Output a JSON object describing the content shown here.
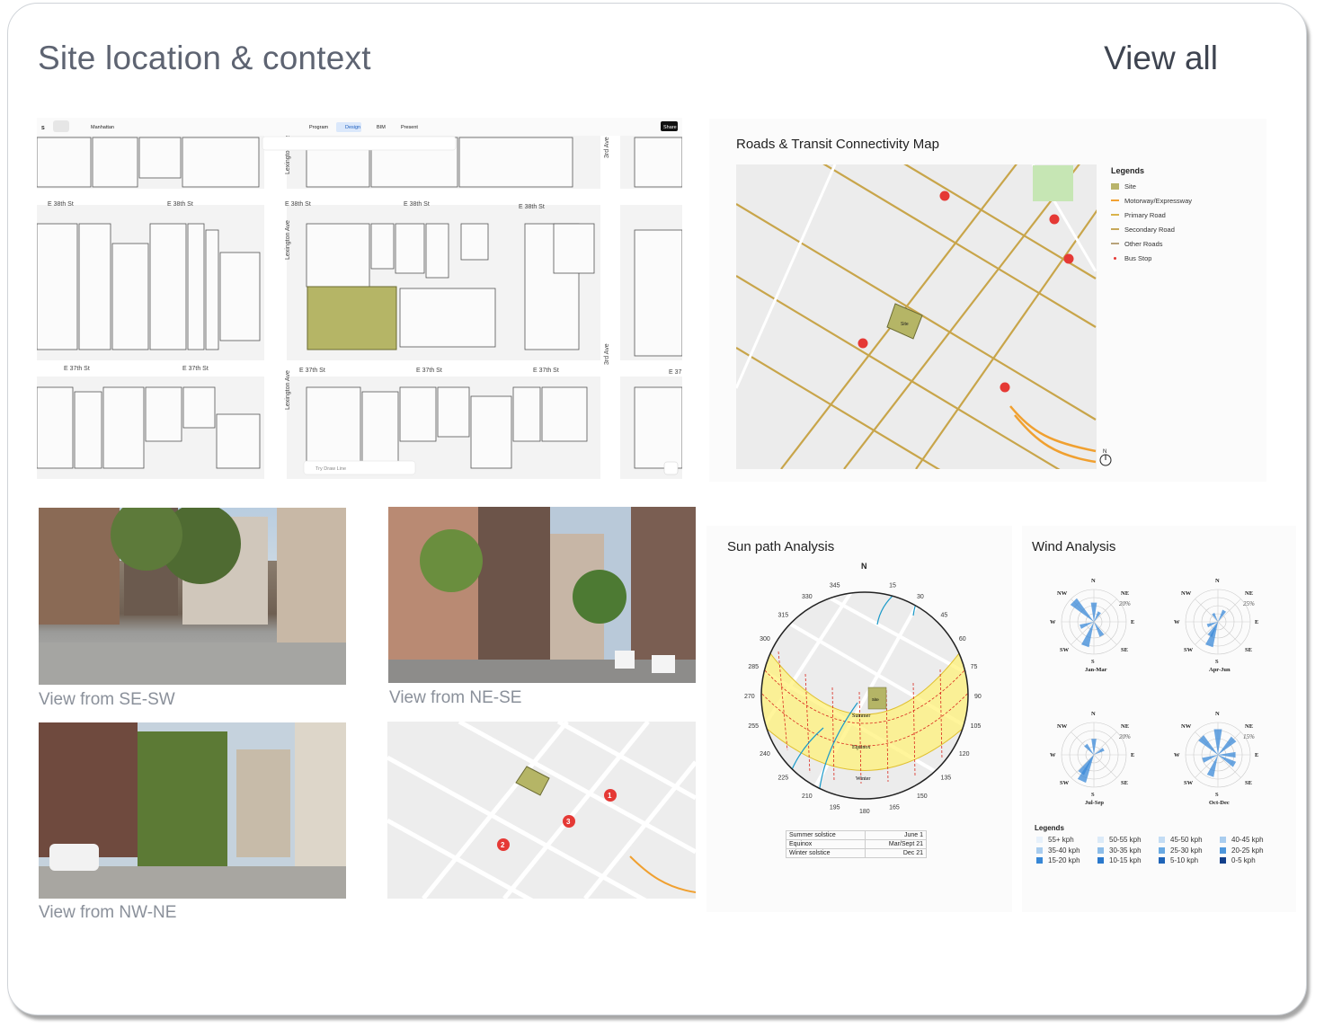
{
  "header": {
    "title": "Site location & context",
    "view_all": "View all"
  },
  "editor": {
    "project": "Manhattan",
    "tabs": [
      "Program",
      "Design",
      "BIM",
      "Present"
    ],
    "active_tab": "Design",
    "share": "Share",
    "search_placeholder": "Try Draw Line",
    "streets": {
      "e38": [
        "E 38th St",
        "E 38th St",
        "E 38th St",
        "E 38th St",
        "E 38th St"
      ],
      "e37": [
        "E 37th St",
        "E 37th St",
        "E 37th St",
        "E 37th St",
        "E 37th St",
        "E 37"
      ],
      "lex": [
        "Lexington Ave",
        "Lexington Ave",
        "Lexington Ave"
      ],
      "third": [
        "3rd Ave",
        "3rd Ave"
      ]
    }
  },
  "roads_map": {
    "title": "Roads & Transit Connectivity Map",
    "site_label": "Site",
    "north": "N",
    "legend_title": "Legends",
    "legend": [
      {
        "label": "Site",
        "color": "#b9b46a",
        "kind": "box"
      },
      {
        "label": "Motorway/Expressway",
        "color": "#f2a233",
        "kind": "line"
      },
      {
        "label": "Primary Road",
        "color": "#d9b34a",
        "kind": "line"
      },
      {
        "label": "Secondary Road",
        "color": "#c7a85a",
        "kind": "line"
      },
      {
        "label": "Other Roads",
        "color": "#b8a37a",
        "kind": "line"
      },
      {
        "label": "Bus Stop",
        "color": "#e53935",
        "kind": "dot"
      }
    ]
  },
  "photos": [
    {
      "caption": "View from SE-SW"
    },
    {
      "caption": "View from NE-SE"
    },
    {
      "caption": "View from NW-NE"
    }
  ],
  "keymap": {
    "markers": [
      "1",
      "2",
      "3"
    ]
  },
  "sun_path": {
    "title": "Sun path Analysis",
    "north": "N",
    "bearings": [
      "345",
      "15",
      "330",
      "30",
      "315",
      "45",
      "300",
      "60",
      "285",
      "75",
      "270",
      "90",
      "255",
      "105",
      "240",
      "120",
      "225",
      "135",
      "210",
      "150",
      "195",
      "165",
      "180"
    ],
    "bands": [
      "Summer",
      "Equinox",
      "Winter"
    ],
    "site_label": "Site",
    "table": [
      {
        "event": "Summer solstice",
        "date": "June 1"
      },
      {
        "event": "Equinox",
        "date": "Mar/Sept 21"
      },
      {
        "event": "Winter solstice",
        "date": "Dec 21"
      }
    ]
  },
  "wind": {
    "title": "Wind Analysis",
    "roses": [
      {
        "period": "Jan-Mar",
        "scale": "20%",
        "dirs": {
          "n": "N",
          "ne": "NE",
          "e": "E",
          "se": "SE",
          "s": "S",
          "sw": "SW",
          "w": "W",
          "nw": "NW"
        }
      },
      {
        "period": "Apr-Jun",
        "scale": "25%",
        "dirs": {
          "n": "N",
          "ne": "NE",
          "e": "E",
          "se": "SE",
          "s": "S",
          "sw": "SW",
          "w": "W",
          "nw": "NW"
        }
      },
      {
        "period": "Jul-Sep",
        "scale": "20%",
        "dirs": {
          "n": "N",
          "ne": "NE",
          "e": "E",
          "se": "SE",
          "s": "S",
          "sw": "SW",
          "w": "W",
          "nw": "NW"
        }
      },
      {
        "period": "Oct-Dec",
        "scale": "15%",
        "dirs": {
          "n": "N",
          "ne": "NE",
          "e": "E",
          "se": "SE",
          "s": "S",
          "sw": "SW",
          "w": "W",
          "nw": "NW"
        }
      }
    ],
    "legend_title": "Legends",
    "legend": [
      {
        "label": "55+ kph",
        "color": "#e7f1fb"
      },
      {
        "label": "50-55 kph",
        "color": "#dbeaf8"
      },
      {
        "label": "45-50 kph",
        "color": "#c3dcf4"
      },
      {
        "label": "40-45 kph",
        "color": "#a9cdef"
      },
      {
        "label": "35-40 kph",
        "color": "#a9cdef"
      },
      {
        "label": "30-35 kph",
        "color": "#8dbde9"
      },
      {
        "label": "25-30 kph",
        "color": "#6aaae3"
      },
      {
        "label": "20-25 kph",
        "color": "#4e97dc"
      },
      {
        "label": "15-20 kph",
        "color": "#3787d6"
      },
      {
        "label": "10-15 kph",
        "color": "#2a78cc"
      },
      {
        "label": "5-10 kph",
        "color": "#1f64b8"
      },
      {
        "label": "0-5 kph",
        "color": "#123f8a"
      }
    ]
  }
}
